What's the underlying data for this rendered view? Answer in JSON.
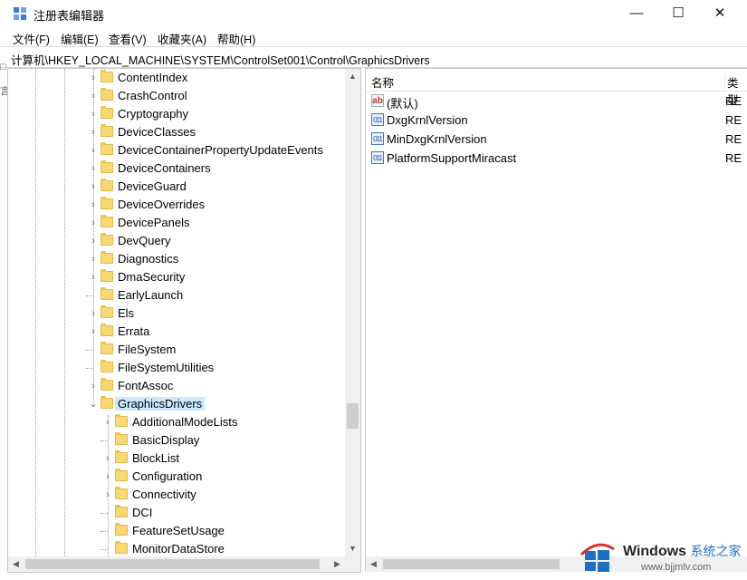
{
  "window": {
    "title": "注册表编辑器",
    "controls": {
      "minimize": "—",
      "maximize": "☐",
      "close": "✕"
    }
  },
  "menu": [
    "文件(F)",
    "编辑(E)",
    "查看(V)",
    "收藏夹(A)",
    "帮助(H)"
  ],
  "address": "计算机\\HKEY_LOCAL_MACHINE\\SYSTEM\\ControlSet001\\Control\\GraphicsDrivers",
  "tree": {
    "items": [
      {
        "label": "ContentIndex",
        "expander": "collapsed"
      },
      {
        "label": "CrashControl",
        "expander": "collapsed"
      },
      {
        "label": "Cryptography",
        "expander": "collapsed"
      },
      {
        "label": "DeviceClasses",
        "expander": "collapsed"
      },
      {
        "label": "DeviceContainerPropertyUpdateEvents",
        "expander": "collapsed"
      },
      {
        "label": "DeviceContainers",
        "expander": "collapsed"
      },
      {
        "label": "DeviceGuard",
        "expander": "collapsed"
      },
      {
        "label": "DeviceOverrides",
        "expander": "collapsed"
      },
      {
        "label": "DevicePanels",
        "expander": "collapsed"
      },
      {
        "label": "DevQuery",
        "expander": "collapsed"
      },
      {
        "label": "Diagnostics",
        "expander": "collapsed"
      },
      {
        "label": "DmaSecurity",
        "expander": "collapsed"
      },
      {
        "label": "EarlyLaunch",
        "expander": "none"
      },
      {
        "label": "Els",
        "expander": "collapsed"
      },
      {
        "label": "Errata",
        "expander": "collapsed"
      },
      {
        "label": "FileSystem",
        "expander": "none"
      },
      {
        "label": "FileSystemUtilities",
        "expander": "none"
      },
      {
        "label": "FontAssoc",
        "expander": "collapsed"
      },
      {
        "label": "GraphicsDrivers",
        "expander": "expanded",
        "selected": true
      },
      {
        "label": "AdditionalModeLists",
        "expander": "collapsed",
        "child": true
      },
      {
        "label": "BasicDisplay",
        "expander": "none",
        "child": true
      },
      {
        "label": "BlockList",
        "expander": "collapsed",
        "child": true
      },
      {
        "label": "Configuration",
        "expander": "collapsed",
        "child": true
      },
      {
        "label": "Connectivity",
        "expander": "collapsed",
        "child": true
      },
      {
        "label": "DCI",
        "expander": "none",
        "child": true
      },
      {
        "label": "FeatureSetUsage",
        "expander": "none",
        "child": true
      },
      {
        "label": "MonitorDataStore",
        "expander": "none",
        "child": true
      }
    ]
  },
  "list": {
    "columns": {
      "name": "名称",
      "type": "类型"
    },
    "rows": [
      {
        "icon": "string-value-icon",
        "name": "(默认)",
        "type": "RE"
      },
      {
        "icon": "binary-value-icon",
        "name": "DxgKrnlVersion",
        "type": "RE"
      },
      {
        "icon": "binary-value-icon",
        "name": "MinDxgKrnlVersion",
        "type": "RE"
      },
      {
        "icon": "binary-value-icon",
        "name": "PlatformSupportMiracast",
        "type": "RE"
      }
    ]
  },
  "watermark": {
    "brand": "Windows",
    "brand_cn": "系统之家",
    "url": "www.bjjmlv.com"
  },
  "colors": {
    "selection": "#cce8ff",
    "folder": "#f8d775",
    "accent": "#1f6fc1"
  }
}
